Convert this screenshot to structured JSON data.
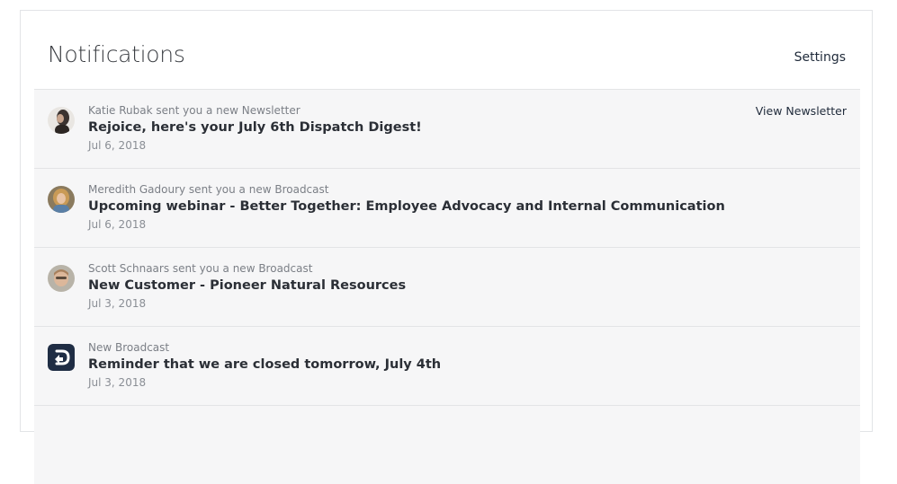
{
  "header": {
    "title": "Notifications",
    "settings_label": "Settings"
  },
  "notifications": [
    {
      "meta": "Katie Rubak sent you a new Newsletter",
      "title": "Rejoice, here's your July 6th Dispatch Digest!",
      "date": "Jul 6, 2018",
      "action": "View Newsletter",
      "avatar": "user-avatar"
    },
    {
      "meta": "Meredith Gadoury sent you a new Broadcast",
      "title": "Upcoming webinar - Better Together: Employee Advocacy and Internal Communication",
      "date": "Jul 6, 2018",
      "avatar": "user-avatar"
    },
    {
      "meta": "Scott Schnaars sent you a new Broadcast",
      "title": "New Customer - Pioneer Natural Resources",
      "date": "Jul 3, 2018",
      "avatar": "user-avatar"
    },
    {
      "meta": "New Broadcast",
      "title": "Reminder that we are closed tomorrow, July 4th",
      "date": "Jul 3, 2018",
      "avatar": "app-logo-icon"
    }
  ],
  "colors": {
    "row_background": "#f6f6f7",
    "logo_background": "#1f2d44",
    "link": "#1f2a3a"
  }
}
